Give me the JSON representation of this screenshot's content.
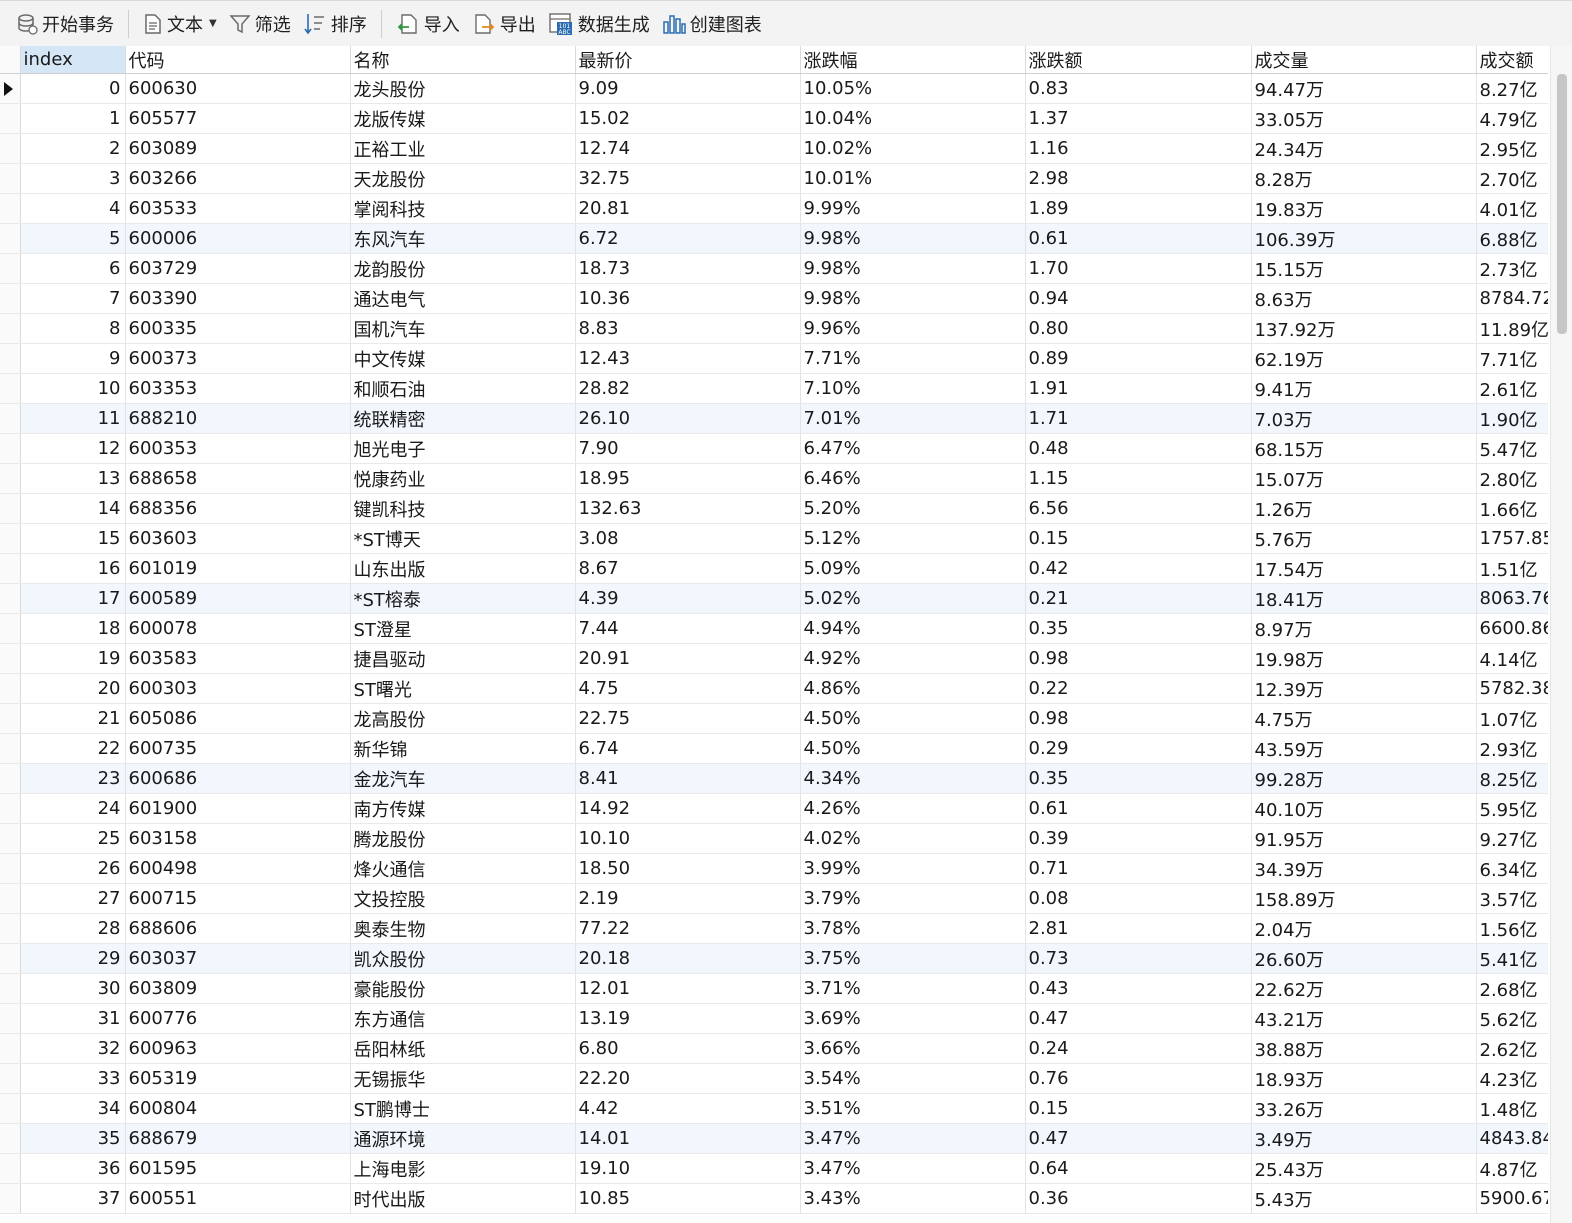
{
  "toolbar": {
    "begin_transaction": "开始事务",
    "text": "文本",
    "filter": "筛选",
    "sort": "排序",
    "import": "导入",
    "export": "导出",
    "data_generate": "数据生成",
    "create_chart": "创建图表"
  },
  "table": {
    "columns": [
      "index",
      "代码",
      "名称",
      "最新价",
      "涨跌幅",
      "涨跌额",
      "成交量",
      "成交额"
    ],
    "rows": [
      [
        "0",
        "600630",
        "龙头股份",
        "9.09",
        "10.05%",
        "0.83",
        "94.47万",
        "8.27亿"
      ],
      [
        "1",
        "605577",
        "龙版传媒",
        "15.02",
        "10.04%",
        "1.37",
        "33.05万",
        "4.79亿"
      ],
      [
        "2",
        "603089",
        "正裕工业",
        "12.74",
        "10.02%",
        "1.16",
        "24.34万",
        "2.95亿"
      ],
      [
        "3",
        "603266",
        "天龙股份",
        "32.75",
        "10.01%",
        "2.98",
        "8.28万",
        "2.70亿"
      ],
      [
        "4",
        "603533",
        "掌阅科技",
        "20.81",
        "9.99%",
        "1.89",
        "19.83万",
        "4.01亿"
      ],
      [
        "5",
        "600006",
        "东风汽车",
        "6.72",
        "9.98%",
        "0.61",
        "106.39万",
        "6.88亿"
      ],
      [
        "6",
        "603729",
        "龙韵股份",
        "18.73",
        "9.98%",
        "1.70",
        "15.15万",
        "2.73亿"
      ],
      [
        "7",
        "603390",
        "通达电气",
        "10.36",
        "9.98%",
        "0.94",
        "8.63万",
        "8784.72"
      ],
      [
        "8",
        "600335",
        "国机汽车",
        "8.83",
        "9.96%",
        "0.80",
        "137.92万",
        "11.89亿"
      ],
      [
        "9",
        "600373",
        "中文传媒",
        "12.43",
        "7.71%",
        "0.89",
        "62.19万",
        "7.71亿"
      ],
      [
        "10",
        "603353",
        "和顺石油",
        "28.82",
        "7.10%",
        "1.91",
        "9.41万",
        "2.61亿"
      ],
      [
        "11",
        "688210",
        "统联精密",
        "26.10",
        "7.01%",
        "1.71",
        "7.03万",
        "1.90亿"
      ],
      [
        "12",
        "600353",
        "旭光电子",
        "7.90",
        "6.47%",
        "0.48",
        "68.15万",
        "5.47亿"
      ],
      [
        "13",
        "688658",
        "悦康药业",
        "18.95",
        "6.46%",
        "1.15",
        "15.07万",
        "2.80亿"
      ],
      [
        "14",
        "688356",
        "键凯科技",
        "132.63",
        "5.20%",
        "6.56",
        "1.26万",
        "1.66亿"
      ],
      [
        "15",
        "603603",
        "*ST博天",
        "3.08",
        "5.12%",
        "0.15",
        "5.76万",
        "1757.85"
      ],
      [
        "16",
        "601019",
        "山东出版",
        "8.67",
        "5.09%",
        "0.42",
        "17.54万",
        "1.51亿"
      ],
      [
        "17",
        "600589",
        "*ST榕泰",
        "4.39",
        "5.02%",
        "0.21",
        "18.41万",
        "8063.76"
      ],
      [
        "18",
        "600078",
        "ST澄星",
        "7.44",
        "4.94%",
        "0.35",
        "8.97万",
        "6600.86"
      ],
      [
        "19",
        "603583",
        "捷昌驱动",
        "20.91",
        "4.92%",
        "0.98",
        "19.98万",
        "4.14亿"
      ],
      [
        "20",
        "600303",
        "ST曙光",
        "4.75",
        "4.86%",
        "0.22",
        "12.39万",
        "5782.38"
      ],
      [
        "21",
        "605086",
        "龙高股份",
        "22.75",
        "4.50%",
        "0.98",
        "4.75万",
        "1.07亿"
      ],
      [
        "22",
        "600735",
        "新华锦",
        "6.74",
        "4.50%",
        "0.29",
        "43.59万",
        "2.93亿"
      ],
      [
        "23",
        "600686",
        "金龙汽车",
        "8.41",
        "4.34%",
        "0.35",
        "99.28万",
        "8.25亿"
      ],
      [
        "24",
        "601900",
        "南方传媒",
        "14.92",
        "4.26%",
        "0.61",
        "40.10万",
        "5.95亿"
      ],
      [
        "25",
        "603158",
        "腾龙股份",
        "10.10",
        "4.02%",
        "0.39",
        "91.95万",
        "9.27亿"
      ],
      [
        "26",
        "600498",
        "烽火通信",
        "18.50",
        "3.99%",
        "0.71",
        "34.39万",
        "6.34亿"
      ],
      [
        "27",
        "600715",
        "文投控股",
        "2.19",
        "3.79%",
        "0.08",
        "158.89万",
        "3.57亿"
      ],
      [
        "28",
        "688606",
        "奥泰生物",
        "77.22",
        "3.78%",
        "2.81",
        "2.04万",
        "1.56亿"
      ],
      [
        "29",
        "603037",
        "凯众股份",
        "20.18",
        "3.75%",
        "0.73",
        "26.60万",
        "5.41亿"
      ],
      [
        "30",
        "603809",
        "豪能股份",
        "12.01",
        "3.71%",
        "0.43",
        "22.62万",
        "2.68亿"
      ],
      [
        "31",
        "600776",
        "东方通信",
        "13.19",
        "3.69%",
        "0.47",
        "43.21万",
        "5.62亿"
      ],
      [
        "32",
        "600963",
        "岳阳林纸",
        "6.80",
        "3.66%",
        "0.24",
        "38.88万",
        "2.62亿"
      ],
      [
        "33",
        "605319",
        "无锡振华",
        "22.20",
        "3.54%",
        "0.76",
        "18.93万",
        "4.23亿"
      ],
      [
        "34",
        "600804",
        "ST鹏博士",
        "4.42",
        "3.51%",
        "0.15",
        "33.26万",
        "1.48亿"
      ],
      [
        "35",
        "688679",
        "通源环境",
        "14.01",
        "3.47%",
        "0.47",
        "3.49万",
        "4843.84"
      ],
      [
        "36",
        "601595",
        "上海电影",
        "19.10",
        "3.47%",
        "0.64",
        "25.43万",
        "4.87亿"
      ],
      [
        "37",
        "600551",
        "时代出版",
        "10.85",
        "3.43%",
        "0.36",
        "5.43万",
        "5900.67"
      ]
    ]
  }
}
